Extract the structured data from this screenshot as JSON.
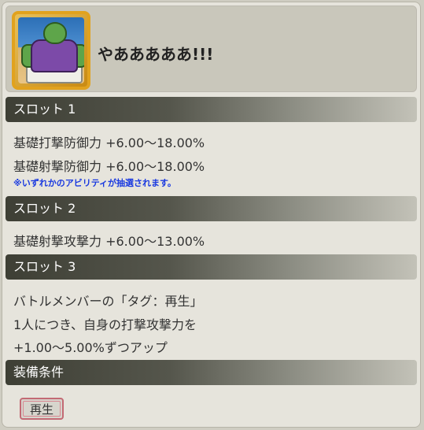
{
  "header": {
    "title": "やあああああ!!!",
    "icon": "character-portrait-icon"
  },
  "slots": [
    {
      "label": "スロット 1",
      "lines": [
        "基礎打撃防御力 +6.00〜18.00%",
        "基礎射撃防御力 +6.00〜18.00%"
      ],
      "note": "※いずれかのアビリティが抽選されます。"
    },
    {
      "label": "スロット 2",
      "lines": [
        "基礎射撃攻撃力 +6.00〜13.00%"
      ]
    },
    {
      "label": "スロット 3",
      "lines": [
        "バトルメンバーの「タグ：再生」",
        "1人につき、自身の打撃攻撃力を",
        "+1.00〜5.00%ずつアップ"
      ]
    }
  ],
  "equip": {
    "label": "装備条件",
    "tag": "再生"
  },
  "colors": {
    "note": "#1838e0",
    "tag_border": "#c36a74",
    "frame_gold": "#e1a21e"
  }
}
